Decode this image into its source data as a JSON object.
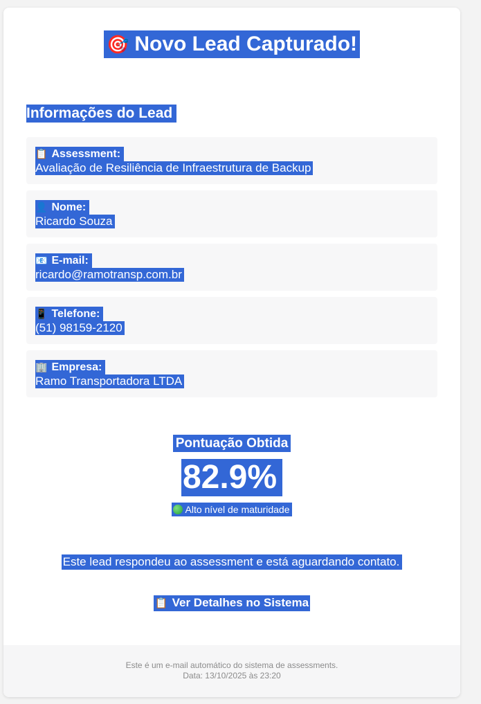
{
  "header": {
    "icon": "target-icon",
    "icon_glyph": "🎯",
    "title": "Novo Lead Capturado!"
  },
  "section": {
    "title": "Informações do Lead"
  },
  "fields": [
    {
      "icon": "clipboard-icon",
      "icon_glyph": "📋",
      "label": "Assessment:",
      "value": "Avaliação de Resiliência de Infraestrutura de Backup"
    },
    {
      "icon": "person-icon",
      "icon_glyph": "👤",
      "label": "Nome:",
      "value": "Ricardo Souza"
    },
    {
      "icon": "email-icon",
      "icon_glyph": "📧",
      "label": "E-mail:",
      "value": "ricardo@ramotransp.com.br"
    },
    {
      "icon": "phone-icon",
      "icon_glyph": "📱",
      "label": "Telefone:",
      "value": "(51) 98159-2120"
    },
    {
      "icon": "building-icon",
      "icon_glyph": "🏢",
      "label": "Empresa:",
      "value": "Ramo Transportadora LTDA"
    }
  ],
  "score": {
    "label": "Pontuação Obtida",
    "value": "82.9%",
    "badge_icon": "green-circle-icon",
    "badge": "Alto nível de maturidade"
  },
  "message": "Este lead respondeu ao assessment e está aguardando contato.",
  "cta": {
    "icon": "clipboard-icon",
    "icon_glyph": "📋",
    "label": "Ver Detalhes no Sistema"
  },
  "footer": {
    "line1": "Este é um e-mail automático do sistema de assessments.",
    "line2": "Data: 13/10/2025 às 23:20"
  },
  "colors": {
    "selection": "#3367d6",
    "page_bg": "#f3f3f3",
    "field_bg": "#f7f7f8",
    "footer_text": "#8b8b8b"
  }
}
